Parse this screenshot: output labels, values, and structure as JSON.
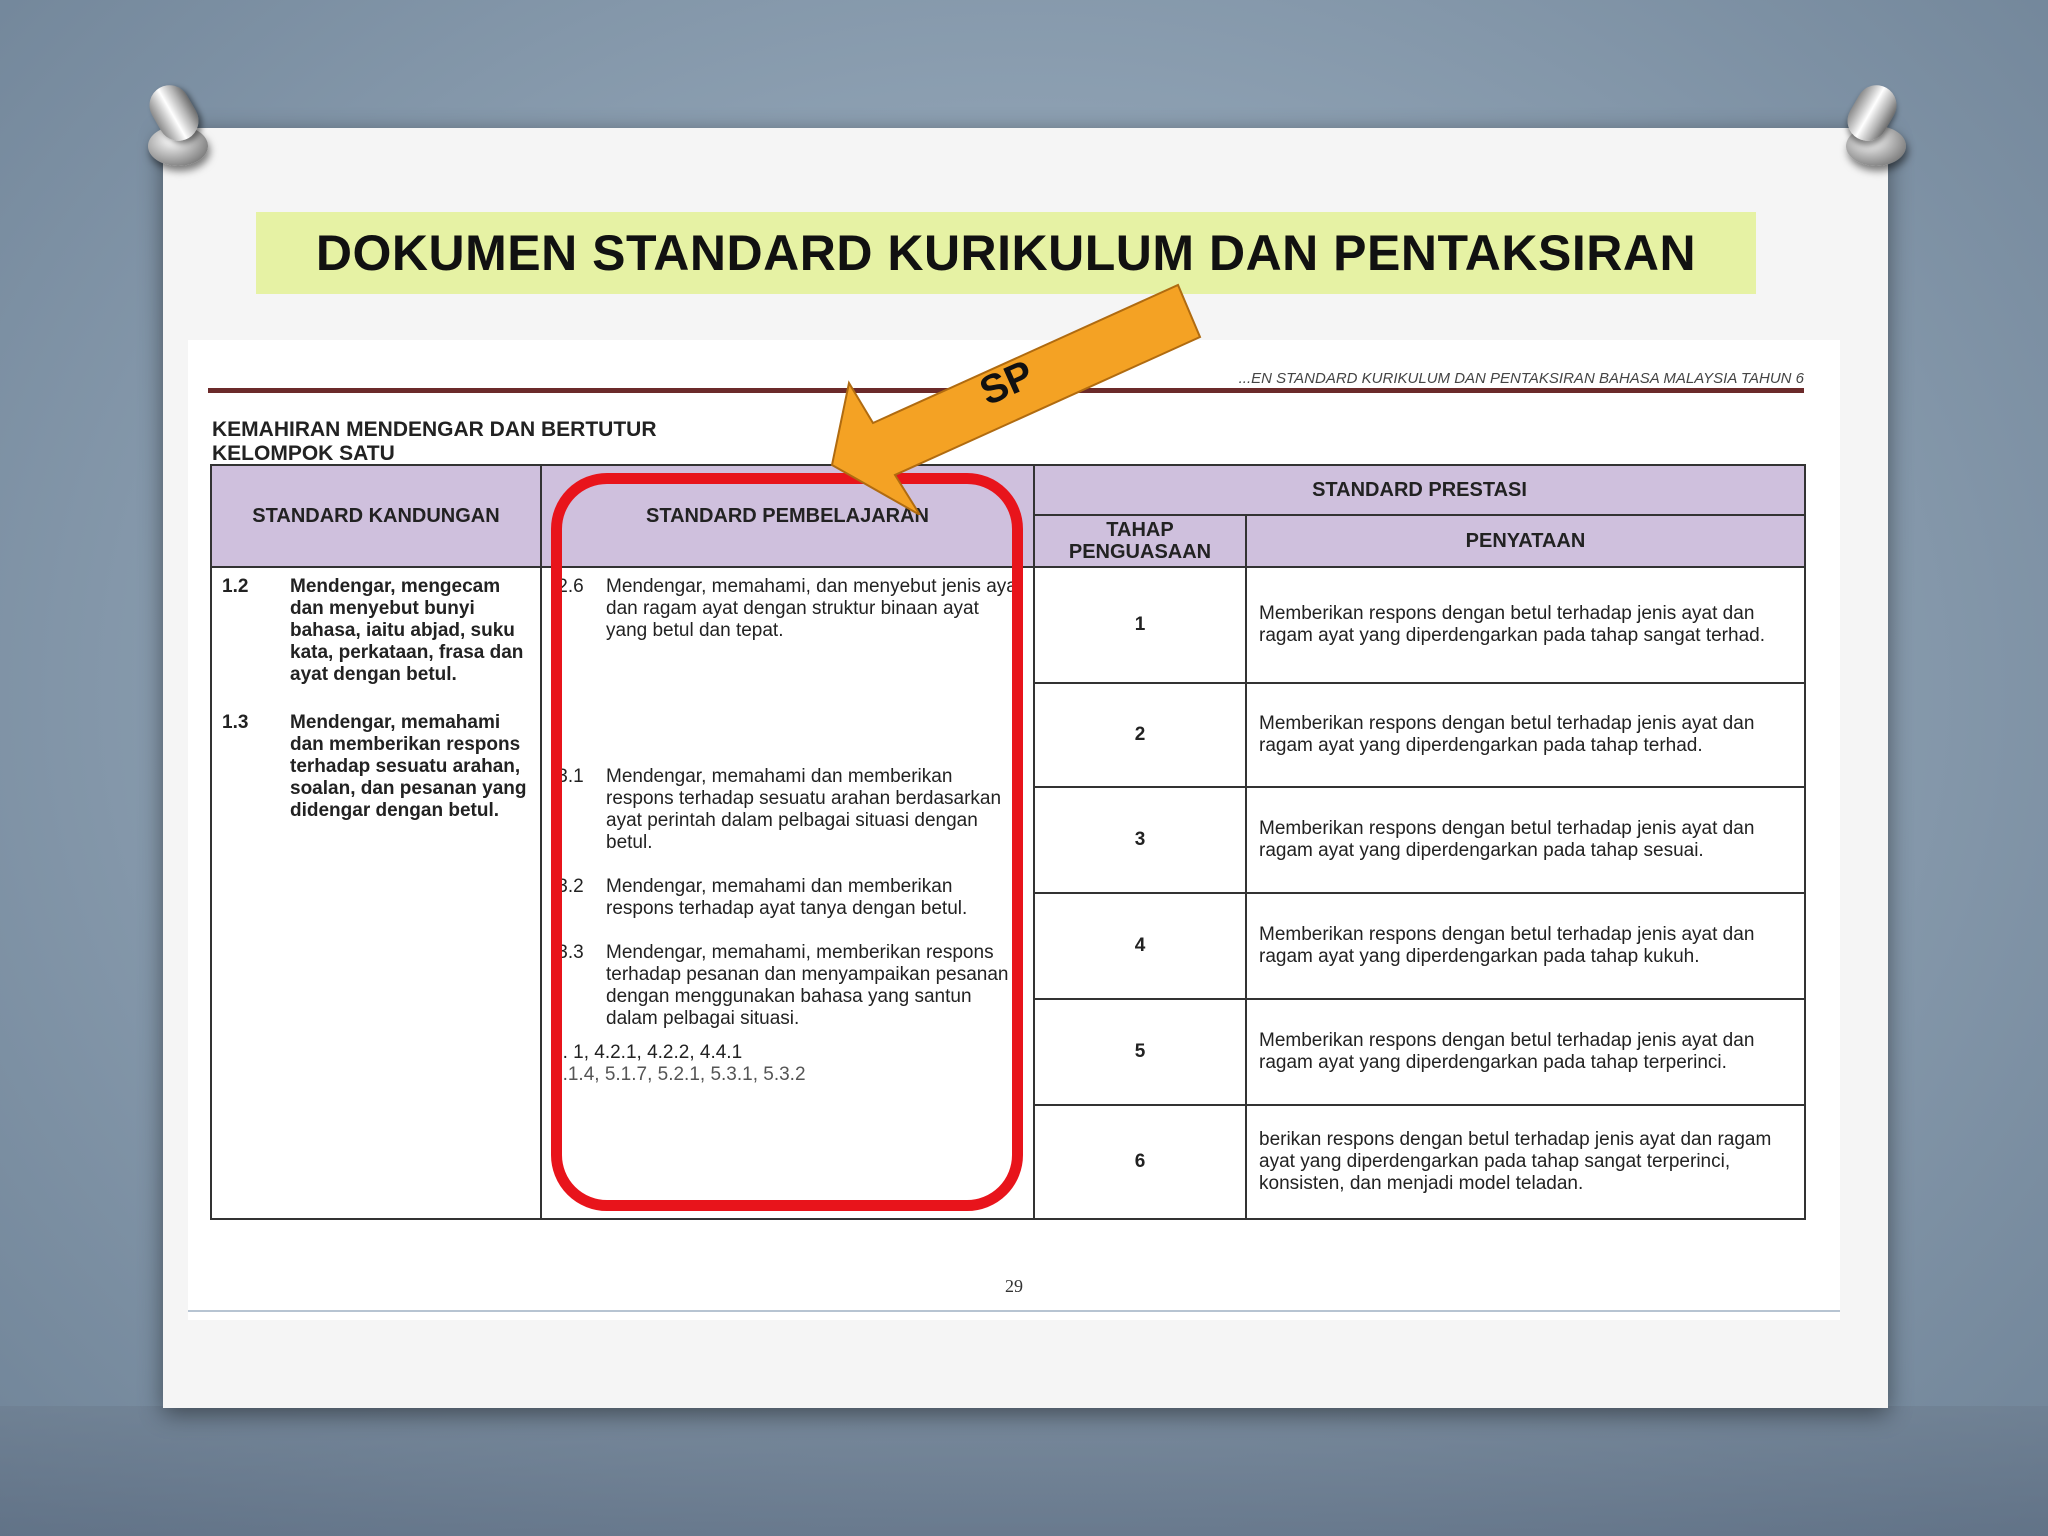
{
  "slide": {
    "title": "DOKUMEN STANDARD KURIKULUM DAN PENTAKSIRAN",
    "arrow_label": "SP"
  },
  "document": {
    "header": "...EN  STANDARD KURIKULUM DAN PENTAKSIRAN BAHASA MALAYSIA TAHUN 6",
    "section_line1": "KEMAHIRAN MENDENGAR DAN BERTUTUR",
    "section_line2": "KELOMPOK SATU",
    "page_number": "29",
    "columns": {
      "sk": "STANDARD KANDUNGAN",
      "sp": "STANDARD PEMBELAJARAN",
      "prestasi": "STANDARD PRESTASI",
      "tahap": "TAHAP PENGUASAAN",
      "penyataan": "PENYATAAN"
    },
    "standard_kandungan": [
      {
        "code": "1.2",
        "text": "Mendengar, mengecam dan menyebut bunyi bahasa, iaitu abjad, suku kata, perkataan, frasa dan ayat dengan betul."
      },
      {
        "code": "1.3",
        "text": "Mendengar, memahami dan memberikan respons terhadap sesuatu arahan, soalan, dan pesanan yang didengar dengan betul."
      }
    ],
    "standard_pembelajaran": [
      {
        "code": ".2.6",
        "text": "Mendengar, memahami, dan menyebut jenis ayat dan ragam ayat dengan  struktur binaan  ayat yang betul dan tepat."
      },
      {
        "code": ".3.1",
        "text": "Mendengar, memahami dan memberikan respons terhadap sesuatu arahan berdasarkan ayat perintah dalam pelbagai situasi dengan betul."
      },
      {
        "code": ".3.2",
        "text": "Mendengar, memahami  dan memberikan respons terhadap ayat tanya dengan betul."
      },
      {
        "code": ".3.3",
        "text": "Mendengar, memahami, memberikan respons  terhadap pesanan  dan menyampaikan pesanan dengan menggunakan bahasa yang santun dalam pelbagai situasi."
      }
    ],
    "sp_refs_line1": "4.   1,  4.2.1,  4.2.2,  4.4.1",
    "sp_refs_line2": "5.1.4,  5.1.7,  5.2.1,  5.3.1,  5.3.2",
    "prestasi": [
      {
        "tahap": "1",
        "penyataan": "Memberikan respons  dengan betul terhadap jenis ayat dan ragam ayat yang diperdengarkan pada tahap sangat terhad."
      },
      {
        "tahap": "2",
        "penyataan": "Memberikan respons  dengan betul terhadap jenis ayat dan ragam ayat yang diperdengarkan pada tahap terhad."
      },
      {
        "tahap": "3",
        "penyataan": "Memberikan respons  dengan betul terhadap jenis ayat dan ragam ayat yang diperdengarkan pada tahap sesuai."
      },
      {
        "tahap": "4",
        "penyataan": "Memberikan respons  dengan betul terhadap jenis ayat dan ragam ayat yang diperdengarkan pada tahap kukuh."
      },
      {
        "tahap": "5",
        "penyataan": "Memberikan respons  dengan betul terhadap jenis ayat dan ragam ayat yang diperdengarkan pada tahap terperinci."
      },
      {
        "tahap": "6",
        "penyataan": "berikan respons  dengan betul terhadap jenis ayat dan ragam ayat yang diperdengarkan pada tahap sangat terperinci, konsisten, dan menjadi model teladan."
      }
    ]
  },
  "colors": {
    "title_band": "#e6f2a4",
    "table_header": "#cfc0dd",
    "highlight_box": "#e8141b",
    "arrow_fill": "#f4a224",
    "rule": "#6b2a2a"
  }
}
